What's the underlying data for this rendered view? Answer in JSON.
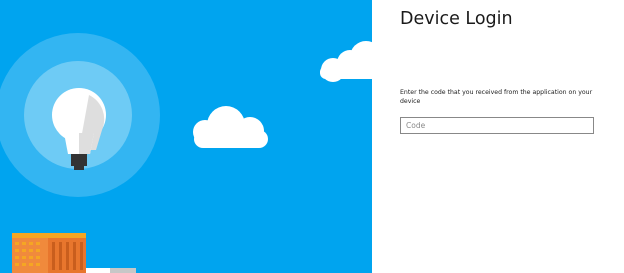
{
  "page": {
    "title": "Device Login",
    "instructions": "Enter the code that you received from the application on your device",
    "code_input": {
      "placeholder": "Code",
      "value": ""
    }
  },
  "illustration": {
    "icons": [
      "lightbulb-icon",
      "cloud-icon",
      "building-icon"
    ],
    "colors": {
      "sky": "#00a4ef",
      "halo_outer": "#33b5f2",
      "halo_inner": "#6ecbf5",
      "bulb": "#ffffff",
      "bulb_shade": "#dedede",
      "bulb_base": "#333333",
      "building": "#e8762d",
      "building_accent": "#f5a623"
    }
  }
}
